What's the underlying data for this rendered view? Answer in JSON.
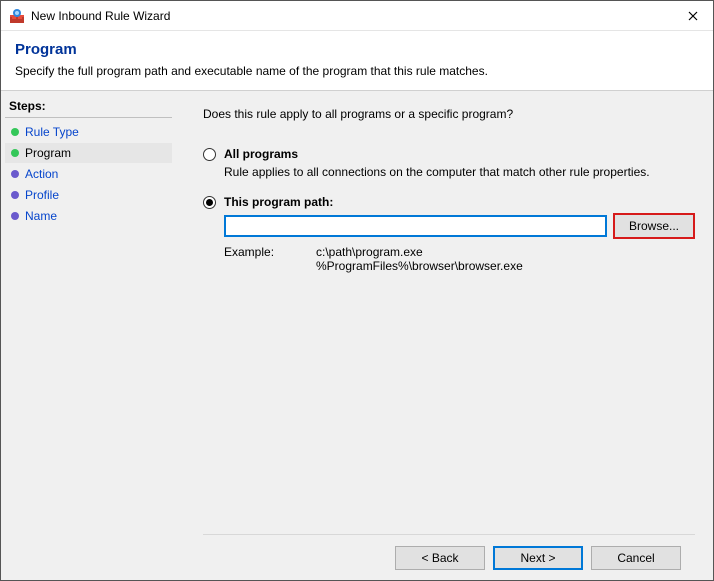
{
  "window": {
    "title": "New Inbound Rule Wizard"
  },
  "header": {
    "title": "Program",
    "description": "Specify the full program path and executable name of the program that this rule matches."
  },
  "sidebar": {
    "label": "Steps:",
    "items": [
      {
        "label": "Rule Type",
        "state": "link",
        "bullet_color": "#34c759"
      },
      {
        "label": "Program",
        "state": "current",
        "bullet_color": "#34c759"
      },
      {
        "label": "Action",
        "state": "link",
        "bullet_color": "#6a5acd"
      },
      {
        "label": "Profile",
        "state": "link",
        "bullet_color": "#6a5acd"
      },
      {
        "label": "Name",
        "state": "link",
        "bullet_color": "#6a5acd"
      }
    ]
  },
  "content": {
    "prompt": "Does this rule apply to all programs or a specific program?",
    "option_all": {
      "label": "All programs",
      "desc": "Rule applies to all connections on the computer that match other rule properties.",
      "selected": false
    },
    "option_path": {
      "label": "This program path:",
      "selected": true,
      "value": "",
      "browse_label": "Browse...",
      "example_label": "Example:",
      "example_values": "c:\\path\\program.exe\n%ProgramFiles%\\browser\\browser.exe"
    }
  },
  "footer": {
    "back": "< Back",
    "next": "Next >",
    "cancel": "Cancel"
  }
}
